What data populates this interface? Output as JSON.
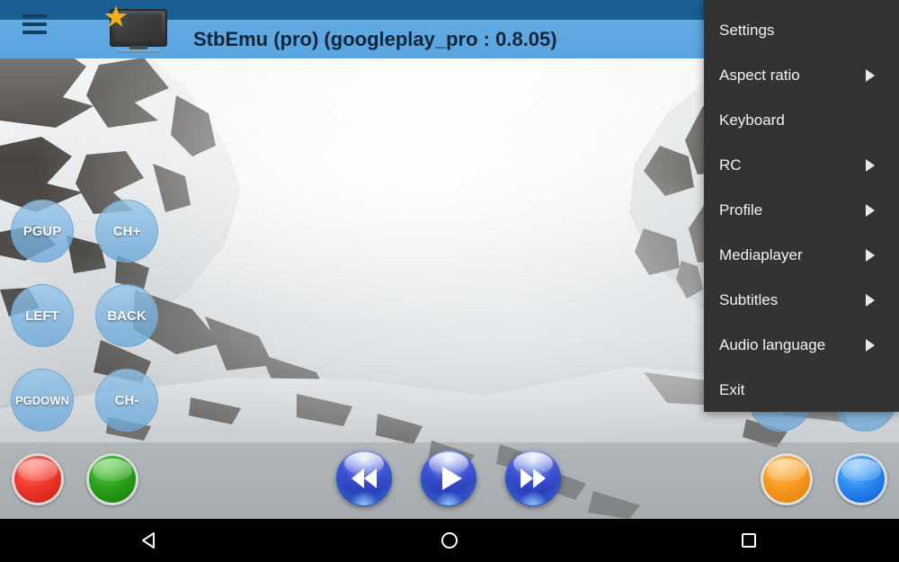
{
  "app": {
    "title": "StbEmu (pro) (googleplay_pro : 0.8.05)",
    "icon_name": "tv-star-icon",
    "menu_icon_name": "hamburger-icon"
  },
  "colors": {
    "status_bar": "#17608f",
    "action_bar": "#5aa4e0",
    "menu_bg": "#333333",
    "menu_text": "#f2f2f2",
    "title_text": "#10263b",
    "rc_button": "#7cb4e0",
    "red_button": "#f0392b",
    "green_button": "#2ca01c",
    "orange_button": "#f79a1e",
    "blue_button": "#2d8bf0",
    "media_button": "#1a2aa8",
    "navbar": "#000000"
  },
  "menu": {
    "items": [
      {
        "label": "Settings",
        "submenu": false
      },
      {
        "label": "Aspect ratio",
        "submenu": true
      },
      {
        "label": "Keyboard",
        "submenu": false
      },
      {
        "label": "RC",
        "submenu": true
      },
      {
        "label": "Profile",
        "submenu": true
      },
      {
        "label": "Mediaplayer",
        "submenu": true
      },
      {
        "label": "Subtitles",
        "submenu": true
      },
      {
        "label": "Audio language",
        "submenu": true
      },
      {
        "label": "Exit",
        "submenu": false
      }
    ]
  },
  "remote": {
    "buttons": [
      {
        "label": "PGUP"
      },
      {
        "label": "CH+"
      },
      {
        "label": "LEFT"
      },
      {
        "label": "BACK"
      },
      {
        "label": "PGDOWN"
      },
      {
        "label": "CH-"
      }
    ]
  },
  "color_buttons": [
    {
      "name": "red-button",
      "color": "red"
    },
    {
      "name": "green-button",
      "color": "green"
    },
    {
      "name": "orange-button",
      "color": "orange"
    },
    {
      "name": "blue-button",
      "color": "blue"
    }
  ],
  "media_controls": [
    {
      "name": "rewind-button",
      "icon": "rewind-icon"
    },
    {
      "name": "play-button",
      "icon": "play-icon"
    },
    {
      "name": "fast-forward-button",
      "icon": "fast-forward-icon"
    }
  ],
  "navbar": {
    "back": "back-icon",
    "home": "home-icon",
    "recents": "recents-icon"
  },
  "video": {
    "description": "snowy mountain peaks"
  }
}
